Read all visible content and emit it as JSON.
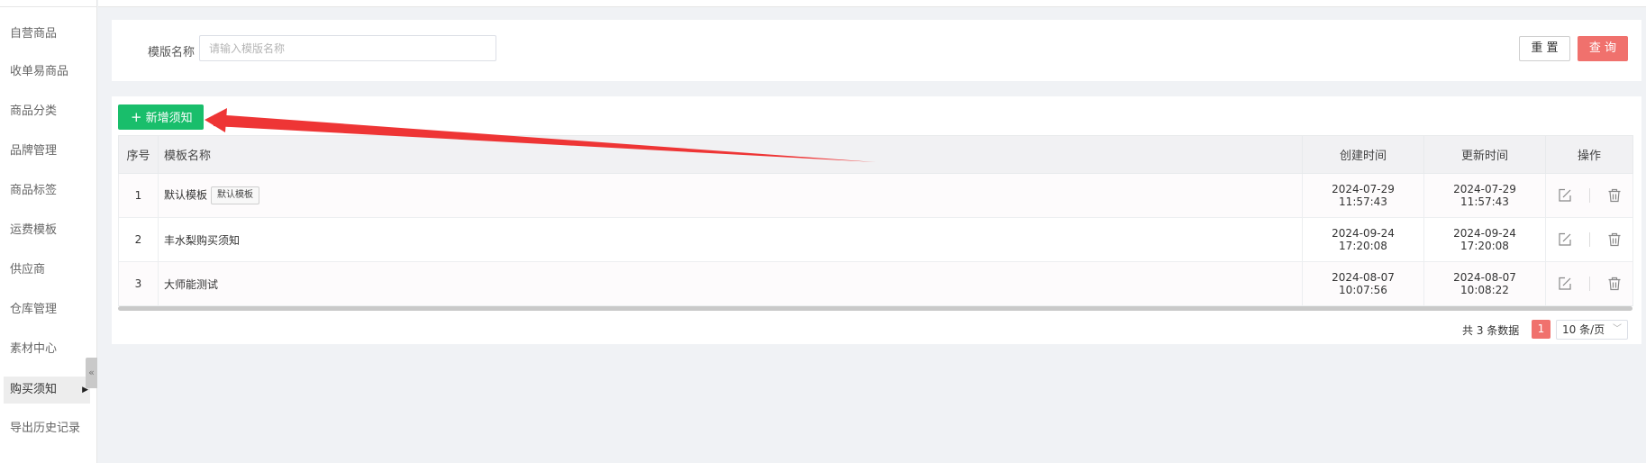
{
  "sidebar": {
    "items": [
      {
        "label": "自营商品",
        "active": false
      },
      {
        "label": "收单易商品",
        "active": false
      },
      {
        "label": "商品分类",
        "active": false
      },
      {
        "label": "品牌管理",
        "active": false
      },
      {
        "label": "商品标签",
        "active": false
      },
      {
        "label": "运费模板",
        "active": false
      },
      {
        "label": "供应商",
        "active": false
      },
      {
        "label": "仓库管理",
        "active": false
      },
      {
        "label": "素材中心",
        "active": false
      },
      {
        "label": "购买须知",
        "active": true
      },
      {
        "label": "导出历史记录",
        "active": false
      }
    ],
    "collapse_icon": "«"
  },
  "search": {
    "label": "模版名称",
    "placeholder": "请输入模版名称",
    "value": "",
    "reset_label": "重 置",
    "query_label": "查 询"
  },
  "toolbar": {
    "add_plus": "+",
    "add_label": "新增须知"
  },
  "table": {
    "headers": {
      "index": "序号",
      "name": "模板名称",
      "created": "创建时间",
      "updated": "更新时间",
      "ops": "操作"
    },
    "rows": [
      {
        "index": "1",
        "name": "默认模板",
        "tag": "默认模板",
        "created": "2024-07-29 11:57:43",
        "updated": "2024-07-29 11:57:43"
      },
      {
        "index": "2",
        "name": "丰水梨购买须知",
        "tag": "",
        "created": "2024-09-24 17:20:08",
        "updated": "2024-09-24 17:20:08"
      },
      {
        "index": "3",
        "name": "大师能测试",
        "tag": "",
        "created": "2024-08-07 10:07:56",
        "updated": "2024-08-07 10:08:22"
      }
    ]
  },
  "pagination": {
    "total_text": "共 3 条数据",
    "current_page": "1",
    "page_size": "10 条/页"
  },
  "colors": {
    "accent_green": "#19be6b",
    "accent_red": "#f0716d",
    "annotation_arrow": "#ee3535"
  }
}
